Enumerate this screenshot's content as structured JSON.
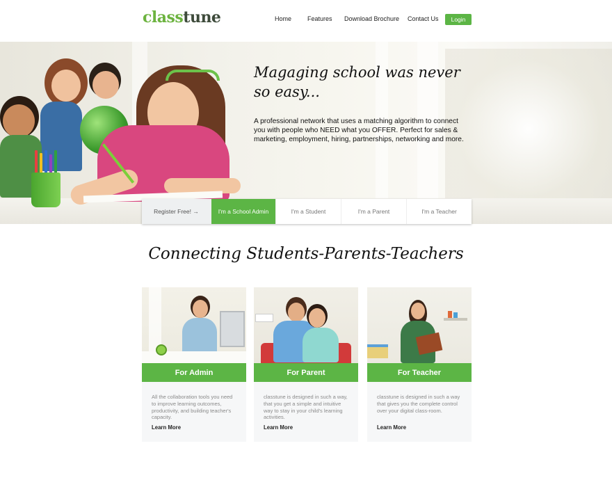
{
  "header": {
    "logo_class": "class",
    "logo_tune": "tune",
    "nav": [
      "Home",
      "Features",
      "Download Brochure",
      "Contact Us"
    ],
    "login_label": "Login"
  },
  "hero": {
    "title": "Magaging school was never so easy...",
    "description": "A professional network that uses a matching algorithm to connect you with people who NEED what you OFFER. Perfect for sales & marketing, employment, hiring, partnerships, networking and more."
  },
  "tabs": {
    "register_label": "Register Free!",
    "register_arrow": "→",
    "roles": [
      "I'm a School Admin",
      "I'm a Student",
      "I'm a Parent",
      "I'm a Teacher"
    ],
    "active_index": 0
  },
  "section": {
    "title": "Connecting Students-Parents-Teachers"
  },
  "cards": [
    {
      "title": "For Admin",
      "text": "All the collaboration tools you need to improve learning outcomes, productivity, and building teacher's capacity.",
      "more": "Learn More"
    },
    {
      "title": "For Parent",
      "text": "classtune is designed in such a way, that you get a simple and intuitive way to stay in your child's learning activities.",
      "more": "Learn More"
    },
    {
      "title": "For Teacher",
      "text": "classtune is designed in such a way that gives you the complete control over your digital class-room.",
      "more": "Learn More"
    }
  ],
  "colors": {
    "brand_green": "#5cb545",
    "logo_dark": "#3d4a3a"
  }
}
